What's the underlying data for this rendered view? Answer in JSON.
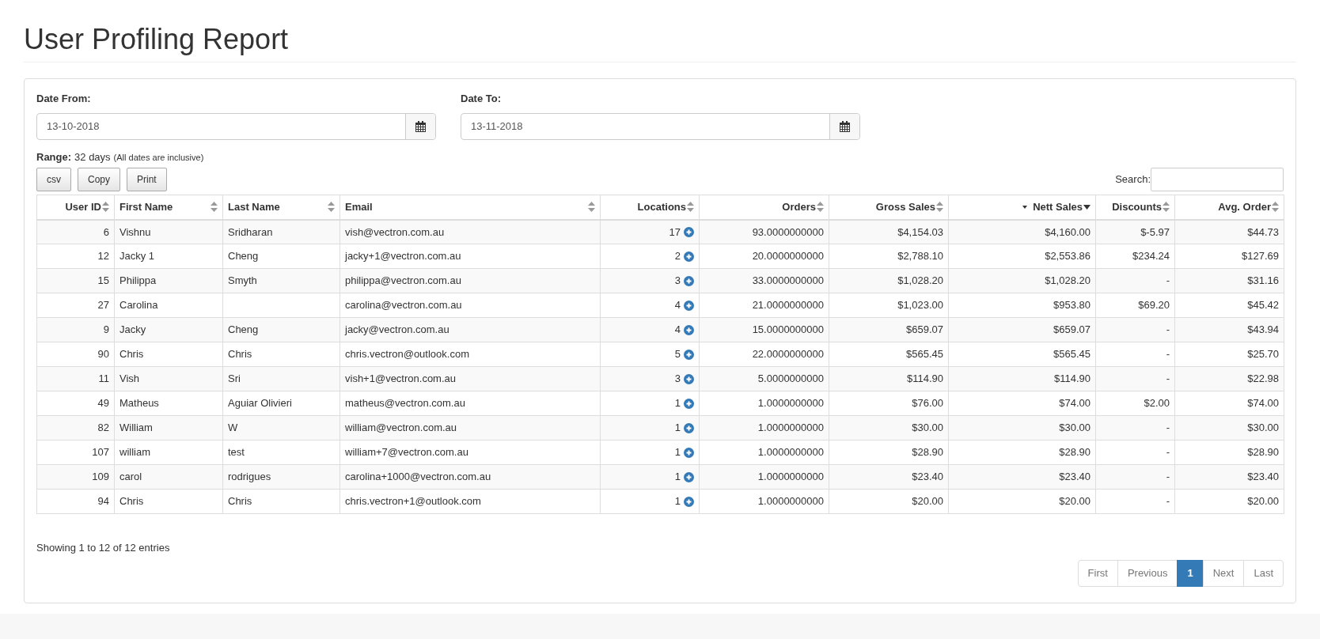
{
  "title": "User Profiling Report",
  "filters": [
    {
      "label": "Date From:",
      "value": "13-10-2018"
    },
    {
      "label": "Date To:",
      "value": "13-11-2018"
    }
  ],
  "range": {
    "label": "Range:",
    "value": "32 days",
    "note": "(All dates are inclusive)"
  },
  "export_buttons": [
    "csv",
    "Copy",
    "Print"
  ],
  "search": {
    "label": "Search:"
  },
  "table": {
    "columns": [
      {
        "label": "User ID",
        "sorted": false
      },
      {
        "label": "First Name",
        "sorted": false
      },
      {
        "label": "Last Name",
        "sorted": false
      },
      {
        "label": "Email",
        "sorted": false
      },
      {
        "label": "Locations",
        "sorted": false
      },
      {
        "label": "Orders",
        "sorted": false
      },
      {
        "label": "Gross Sales",
        "sorted": false
      },
      {
        "label": "Nett Sales",
        "sorted": true
      },
      {
        "label": "Discounts",
        "sorted": false
      },
      {
        "label": "Avg. Order",
        "sorted": false
      }
    ],
    "rows": [
      [
        "6",
        "Vishnu",
        "Sridharan",
        "vish@vectron.com.au",
        "17",
        "93.0000000000",
        "$4,154.03",
        "$4,160.00",
        "$-5.97",
        "$44.73"
      ],
      [
        "12",
        "Jacky 1",
        "Cheng",
        "jacky+1@vectron.com.au",
        "2",
        "20.0000000000",
        "$2,788.10",
        "$2,553.86",
        "$234.24",
        "$127.69"
      ],
      [
        "15",
        "Philippa",
        "Smyth",
        "philippa@vectron.com.au",
        "3",
        "33.0000000000",
        "$1,028.20",
        "$1,028.20",
        "-",
        "$31.16"
      ],
      [
        "27",
        "Carolina",
        "",
        "carolina@vectron.com.au",
        "4",
        "21.0000000000",
        "$1,023.00",
        "$953.80",
        "$69.20",
        "$45.42"
      ],
      [
        "9",
        "Jacky",
        "Cheng",
        "jacky@vectron.com.au",
        "4",
        "15.0000000000",
        "$659.07",
        "$659.07",
        "-",
        "$43.94"
      ],
      [
        "90",
        "Chris",
        "Chris",
        "chris.vectron@outlook.com",
        "5",
        "22.0000000000",
        "$565.45",
        "$565.45",
        "-",
        "$25.70"
      ],
      [
        "11",
        "Vish",
        "Sri",
        "vish+1@vectron.com.au",
        "3",
        "5.0000000000",
        "$114.90",
        "$114.90",
        "-",
        "$22.98"
      ],
      [
        "49",
        "Matheus",
        "Aguiar Olivieri",
        "matheus@vectron.com.au",
        "1",
        "1.0000000000",
        "$76.00",
        "$74.00",
        "$2.00",
        "$74.00"
      ],
      [
        "82",
        "William",
        "W",
        "william@vectron.com.au",
        "1",
        "1.0000000000",
        "$30.00",
        "$30.00",
        "-",
        "$30.00"
      ],
      [
        "107",
        "william",
        "test",
        "william+7@vectron.com.au",
        "1",
        "1.0000000000",
        "$28.90",
        "$28.90",
        "-",
        "$28.90"
      ],
      [
        "109",
        "carol",
        "rodrigues",
        "carolina+1000@vectron.com.au",
        "1",
        "1.0000000000",
        "$23.40",
        "$23.40",
        "-",
        "$23.40"
      ],
      [
        "94",
        "Chris",
        "Chris",
        "chris.vectron+1@outlook.com",
        "1",
        "1.0000000000",
        "$20.00",
        "$20.00",
        "-",
        "$20.00"
      ]
    ]
  },
  "info": "Showing 1 to 12 of 12 entries",
  "pagination": [
    {
      "label": "First",
      "selected": false
    },
    {
      "label": "Previous",
      "selected": false
    },
    {
      "label": "1",
      "selected": true
    },
    {
      "label": "Next",
      "selected": false
    },
    {
      "label": "Last",
      "selected": false
    }
  ]
}
